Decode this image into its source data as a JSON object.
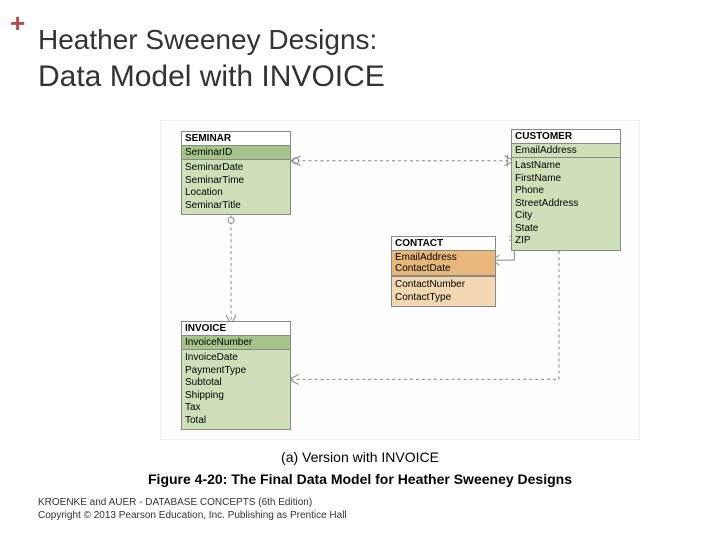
{
  "header": {
    "plus": "+",
    "title": "Heather Sweeney Designs:",
    "subtitle": "Data Model with INVOICE"
  },
  "entities": {
    "seminar": {
      "name": "SEMINAR",
      "pk": "SeminarID",
      "attrs": [
        "SeminarDate",
        "SeminarTime",
        "Location",
        "SeminarTitle"
      ]
    },
    "customer": {
      "name": "CUSTOMER",
      "pk": "EmailAddress",
      "attrs": [
        "LastName",
        "FirstName",
        "Phone",
        "StreetAddress",
        "City",
        "State",
        "ZIP"
      ]
    },
    "contact": {
      "name": "CONTACT",
      "pk": [
        "EmailAddress",
        "ContactDate"
      ],
      "attrs": [
        "ContactNumber",
        "ContactType"
      ]
    },
    "invoice": {
      "name": "INVOICE",
      "pk": "InvoiceNumber",
      "attrs": [
        "InvoiceDate",
        "PaymentType",
        "Subtotal",
        "Shipping",
        "Tax",
        "Total"
      ]
    }
  },
  "caption": {
    "line1": "(a) Version with INVOICE",
    "line2": "Figure 4-20:  The Final Data Model for Heather Sweeney Designs"
  },
  "footer": {
    "line1": "KROENKE and AUER -  DATABASE CONCEPTS (6th Edition)",
    "line2": "Copyright © 2013 Pearson Education, Inc. Publishing as Prentice Hall"
  }
}
